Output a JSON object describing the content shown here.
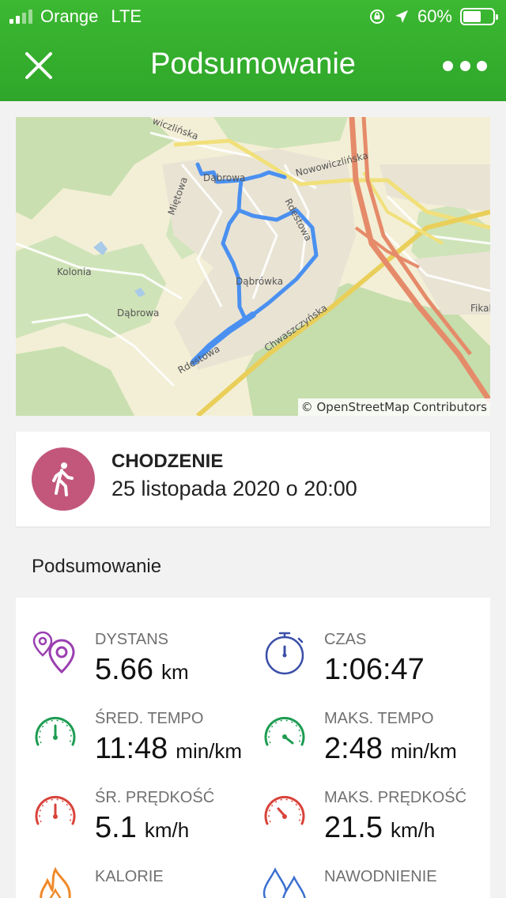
{
  "status_bar": {
    "carrier": "Orange",
    "network": "LTE",
    "battery": "60%",
    "battery_level": 0.6
  },
  "header": {
    "title": "Podsumowanie"
  },
  "map": {
    "attribution": "© OpenStreetMap Contributors",
    "labels": {
      "nowowiczlinska": "Nowowiczlińska",
      "dabrowa_top": "Dąbrowa",
      "mietowa": "Miętowa",
      "rdestowa": "Rdestowa",
      "kolonia": "Kolonia",
      "dabrowka": "Dąbrówka",
      "dabrowa": "Dąbrowa",
      "fikak": "Fikak",
      "chwaszczynska": "Chwaszczyńska",
      "rdestowa2": "Rdestowa",
      "wiczlinska": "wiczlińska"
    },
    "route_color": "#4a90f0"
  },
  "activity": {
    "type": "CHODZENIE",
    "date": "25 listopada 2020 o 20:00",
    "color": "#c2577b"
  },
  "summary": {
    "title": "Podsumowanie",
    "stats": {
      "distance": {
        "label": "DYSTANS",
        "value": "5.66",
        "unit": "km",
        "icon": "map-pins-icon"
      },
      "time": {
        "label": "CZAS",
        "value": "1:06:47",
        "unit": "",
        "icon": "stopwatch-icon"
      },
      "avg_pace": {
        "label": "ŚRED. TEMPO",
        "value": "11:48",
        "unit": "min/km",
        "icon": "gauge-green-icon"
      },
      "max_pace": {
        "label": "MAKS. TEMPO",
        "value": "2:48",
        "unit": "min/km",
        "icon": "gauge-green-icon"
      },
      "avg_speed": {
        "label": "ŚR. PRĘDKOŚĆ",
        "value": "5.1",
        "unit": "km/h",
        "icon": "gauge-red-icon"
      },
      "max_speed": {
        "label": "MAKS. PRĘDKOŚĆ",
        "value": "21.5",
        "unit": "km/h",
        "icon": "gauge-red-icon"
      },
      "calories": {
        "label": "KALORIE",
        "value": "",
        "unit": "",
        "icon": "flame-icon"
      },
      "hydration": {
        "label": "NAWODNIENIE",
        "value": "",
        "unit": "",
        "icon": "water-drops-icon"
      }
    }
  },
  "colors": {
    "header_green": "#34ac2c",
    "pace_green": "#1e9c52",
    "speed_red": "#d8433a",
    "distance_purple": "#9a3fb0",
    "time_blue": "#3b4fa8",
    "calories_orange": "#f0892a",
    "hydration_blue": "#3b6fd0"
  }
}
